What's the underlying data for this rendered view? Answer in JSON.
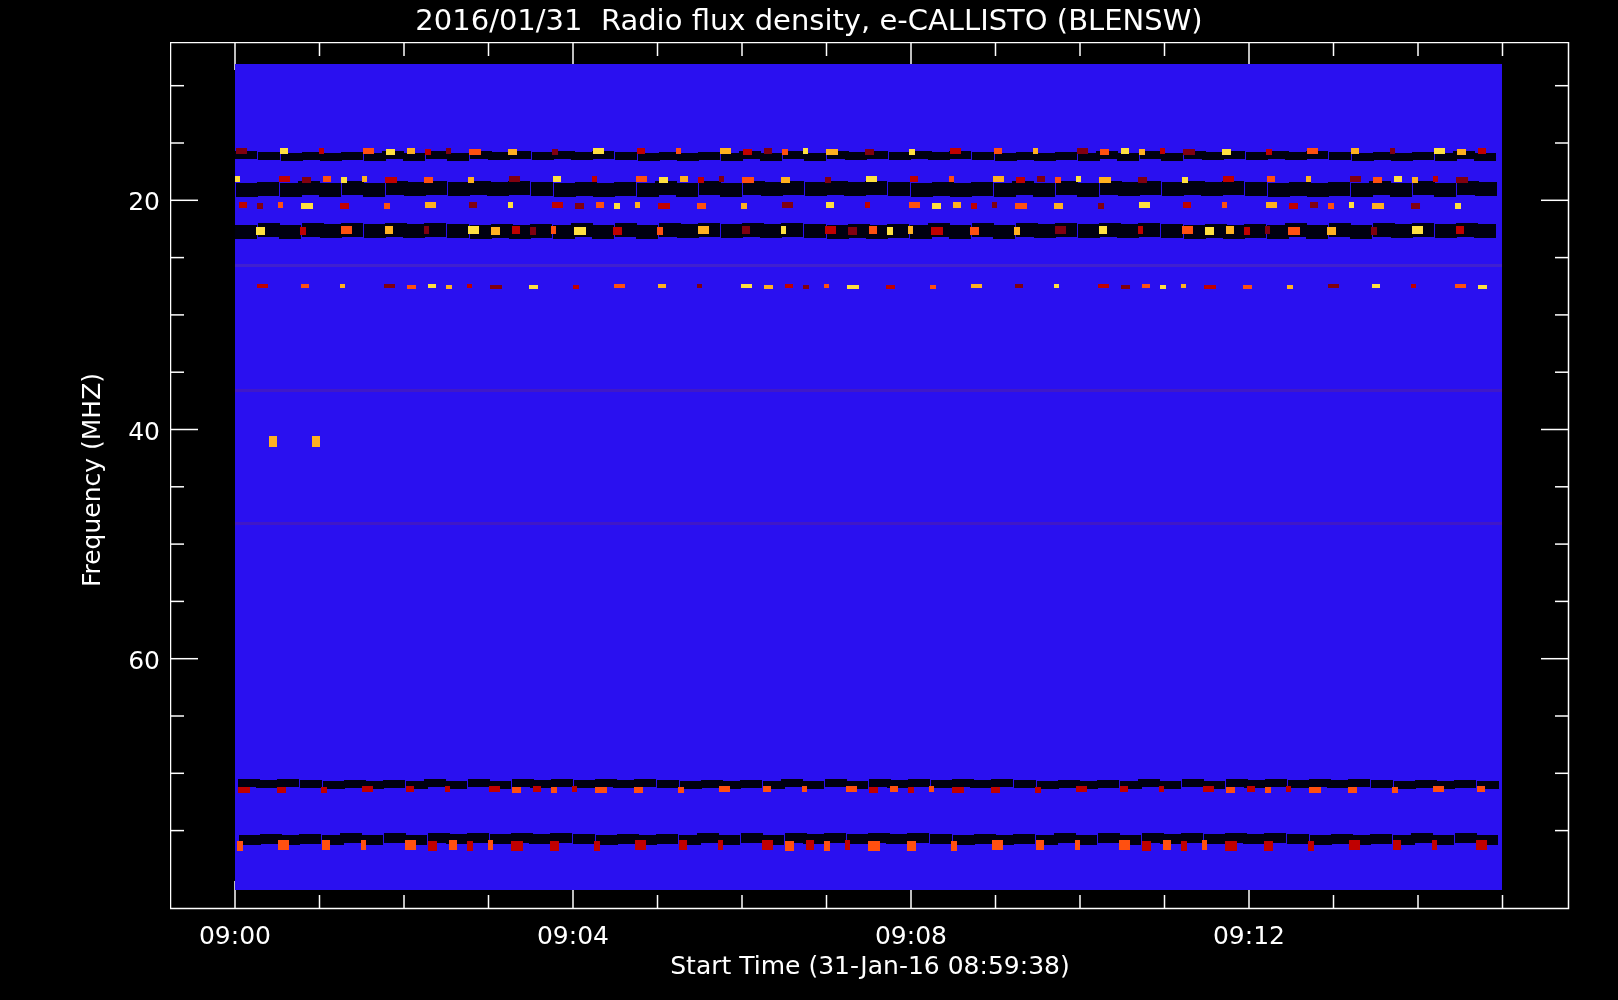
{
  "title": "2016/01/31  Radio flux density, e-CALLISTO (BLENSW)",
  "y_axis": {
    "label": "Frequency (MHZ)",
    "ticks": [
      "20",
      "40",
      "60"
    ]
  },
  "x_axis": {
    "label": "Start Time (31-Jan-16 08:59:38)",
    "ticks": [
      "09:00",
      "09:04",
      "09:08",
      "09:12"
    ]
  }
}
